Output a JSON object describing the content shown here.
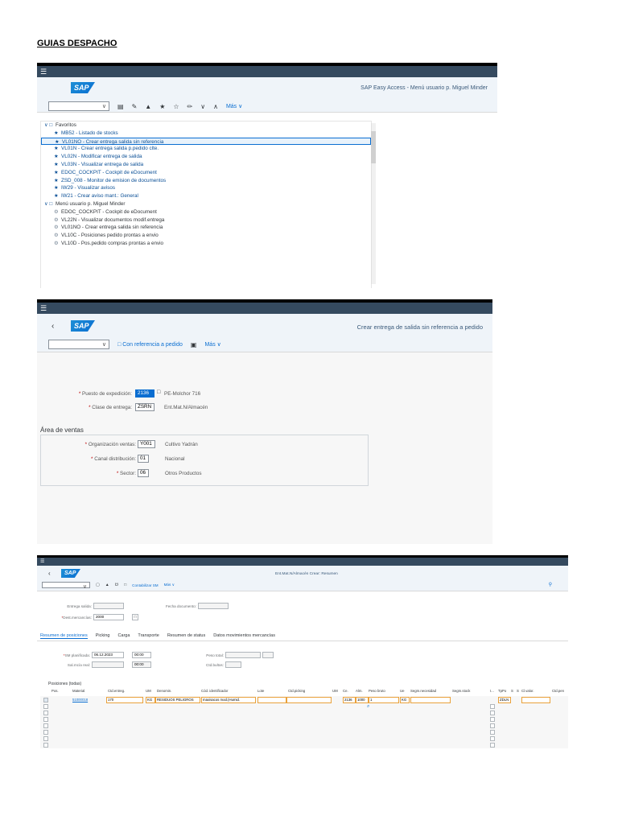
{
  "document": {
    "heading": "GUIAS DESPACHO"
  },
  "screen1": {
    "logo": "SAP",
    "title": "SAP Easy Access  -  Menú usuario p. Miguel Minder",
    "toolbar": {
      "more": "Más"
    },
    "tree": [
      {
        "type": "folder",
        "label": "Favoritos"
      },
      {
        "type": "fav",
        "label": "MB52 - Listado de stocks"
      },
      {
        "type": "fav",
        "label": "VL01NO - Crear entrega salida sin referencia",
        "selected": true
      },
      {
        "type": "fav",
        "label": "VL01N - Crear entrega salida p.pedido clte."
      },
      {
        "type": "fav",
        "label": "VL02N - Modificar entrega de salida"
      },
      {
        "type": "fav",
        "label": "VL03N - Visualizar entrega de salida"
      },
      {
        "type": "fav",
        "label": "EDOC_COCKPIT - Cockpit de eDocument"
      },
      {
        "type": "fav",
        "label": "ZSD_008 - Monitor de emision de documentos"
      },
      {
        "type": "fav",
        "label": "IW29 - Visualizar avisos"
      },
      {
        "type": "fav",
        "label": "IW21 - Crear aviso mant.: General"
      },
      {
        "type": "folder",
        "label": "Menú usuario p. Miguel Minder"
      },
      {
        "type": "tx",
        "label": "EDOC_COCKPIT - Cockpit de eDocument"
      },
      {
        "type": "tx",
        "label": "VL22N - Visualizar documentos modif.entrega"
      },
      {
        "type": "tx",
        "label": "VL01NO - Crear entrega salida sin referencia"
      },
      {
        "type": "tx",
        "label": "VL10C - Posiciones pedido prontas a envio"
      },
      {
        "type": "tx",
        "label": "VL10D - Pos.pedido compras prontas a envio"
      }
    ]
  },
  "screen2": {
    "logo": "SAP",
    "title": "Crear entrega de salida sin referencia a pedido",
    "toolbar": {
      "with_ref": "Con referencia a pedido",
      "more": "Más"
    },
    "fields": {
      "puesto_label": "Puesto de expedición:",
      "puesto_value": "2136",
      "puesto_desc": "PE-Molchor 716",
      "clase_label": "Clase de entrega:",
      "clase_value": "ZSRN",
      "clase_desc": "Ent.Mat.N/Almacén"
    },
    "sales_area": {
      "title": "Área de ventas",
      "org_label": "Organización ventas:",
      "org_value": "Y001",
      "org_desc": "Cultivo Yadrán",
      "canal_label": "Canal distribución:",
      "canal_value": "01",
      "canal_desc": "Nacional",
      "sector_label": "Sector:",
      "sector_value": "06",
      "sector_desc": "Otros Productos"
    }
  },
  "screen3": {
    "logo": "SAP",
    "title": "Ent.Mat.N/Almacén Crear: Resumen",
    "toolbar": {
      "contab": "Contabilizar SM",
      "more": "Más"
    },
    "header_fields": {
      "entrega_label": "Entrega salida:",
      "fecha_doc_label": "Fecha documento:",
      "dest_label": "Dest.mercancías:",
      "dest_value": "2000"
    },
    "tabs": [
      "Resumen de posiciones",
      "Picking",
      "Carga",
      "Transporte",
      "Resumen de status",
      "Datos movimientos mercancías"
    ],
    "dates": {
      "sm_label": "SM planificada:",
      "sm_date": "06.12.2023",
      "sm_time": "00:00",
      "salreal_label": "Sal.mcía real:",
      "salreal_time": "00:00",
      "peso_label": "Peso total:",
      "bultos_label": "Ctd.bultos:"
    },
    "positions_title": "Posiciones (todas)",
    "columns": [
      "Pos.",
      "Material",
      "Ctd.entreg.",
      "UM",
      "Denomin.",
      "Cód. identificador",
      "Lote",
      "Ctd.picking",
      "UM",
      "Ce.",
      "Alm.",
      "Peso bruto",
      "Ue",
      "Segm.necesidad",
      "Segm.stock",
      "I...",
      "TpPo",
      "S",
      "S",
      "Cl.valor.",
      "Ctd.pen"
    ],
    "row": {
      "material": "51000018",
      "cantidad": "170",
      "um": "KG",
      "denom": "RESIDUOS PELIGROS",
      "codigo": "maxisacos mod.(Humid.",
      "ce": "2136",
      "alm": "1000",
      "peso": "1",
      "ue": "KG",
      "tppo": "ZDLN"
    }
  }
}
